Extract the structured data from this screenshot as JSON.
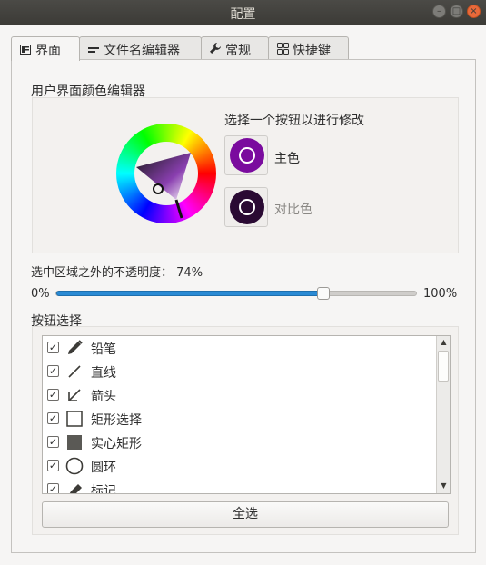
{
  "window": {
    "title": "配置"
  },
  "tabs": [
    {
      "label": "界面",
      "icon": "interface-icon"
    },
    {
      "label": "文件名编辑器",
      "icon": "filename-icon"
    },
    {
      "label": "常规",
      "icon": "wrench-icon"
    },
    {
      "label": "快捷键",
      "icon": "grid-icon"
    }
  ],
  "color_editor": {
    "heading": "用户界面颜色编辑器",
    "prompt": "选择一个按钮以进行修改",
    "main_color_label": "主色",
    "contrast_color_label": "对比色",
    "main_color": "#7a0b9e",
    "contrast_color": "#2a0a33"
  },
  "opacity": {
    "label": "选中区域之外的不透明度：",
    "value_text": "74%",
    "value": 0.74,
    "min_label": "0%",
    "max_label": "100%"
  },
  "buttons": {
    "heading": "按钮选择",
    "items": [
      {
        "label": "铅笔",
        "checked": true,
        "icon": "pencil-icon"
      },
      {
        "label": "直线",
        "checked": true,
        "icon": "line-icon"
      },
      {
        "label": "箭头",
        "checked": true,
        "icon": "arrow-icon"
      },
      {
        "label": "矩形选择",
        "checked": true,
        "icon": "rectangle-icon"
      },
      {
        "label": "实心矩形",
        "checked": true,
        "icon": "filled-rectangle-icon"
      },
      {
        "label": "圆环",
        "checked": true,
        "icon": "circle-icon"
      },
      {
        "label": "标记",
        "checked": true,
        "icon": "marker-icon"
      }
    ],
    "select_all_label": "全选",
    "check_mark": "✓"
  }
}
